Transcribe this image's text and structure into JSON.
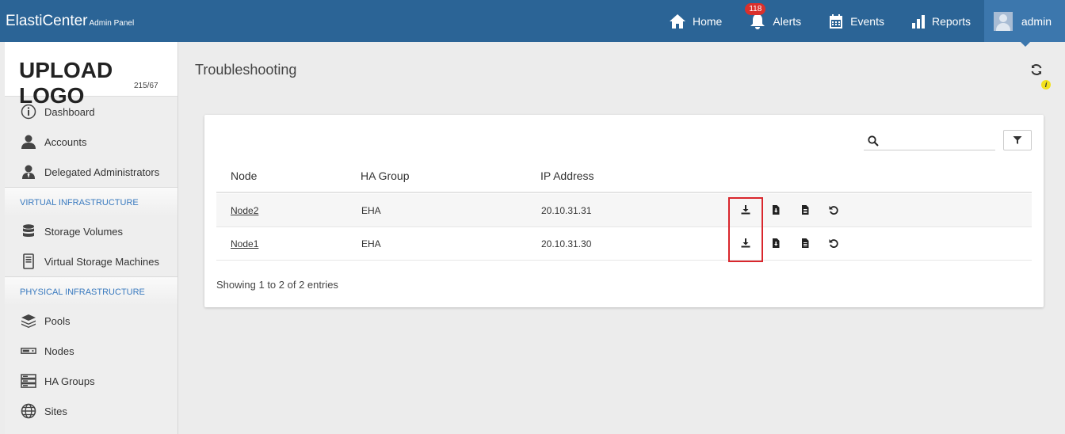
{
  "header": {
    "brand": "ElastiCenter",
    "brand_sub": "Admin Panel",
    "nav": [
      {
        "label": "Home",
        "icon": "home-icon"
      },
      {
        "label": "Alerts",
        "icon": "bell-icon",
        "badge": "118"
      },
      {
        "label": "Events",
        "icon": "calendar-icon"
      },
      {
        "label": "Reports",
        "icon": "bar-chart-icon"
      },
      {
        "label": "admin",
        "icon": "avatar"
      }
    ]
  },
  "sidebar": {
    "logo_title": "UPLOAD LOGO",
    "logo_dims": "215/67",
    "items_top": [
      {
        "label": "Dashboard",
        "icon": "info-circle-icon"
      },
      {
        "label": "Accounts",
        "icon": "user-icon"
      },
      {
        "label": "Delegated Administrators",
        "icon": "user-tie-icon"
      }
    ],
    "section_virtual": "VIRTUAL INFRASTRUCTURE",
    "items_virtual": [
      {
        "label": "Storage Volumes",
        "icon": "database-icon"
      },
      {
        "label": "Virtual Storage Machines",
        "icon": "server-tower-icon"
      }
    ],
    "section_physical": "PHYSICAL INFRASTRUCTURE",
    "items_physical": [
      {
        "label": "Pools",
        "icon": "layers-icon"
      },
      {
        "label": "Nodes",
        "icon": "node-bar-icon"
      },
      {
        "label": "HA Groups",
        "icon": "server-stack-icon"
      },
      {
        "label": "Sites",
        "icon": "globe-icon"
      }
    ]
  },
  "main": {
    "title": "Troubleshooting",
    "info_marker": "i",
    "search": {
      "placeholder": "",
      "value": ""
    },
    "table": {
      "columns": [
        "Node",
        "HA Group",
        "IP Address"
      ],
      "rows": [
        {
          "node": "Node2",
          "ha_group": "EHA",
          "ip": "20.10.31.31"
        },
        {
          "node": "Node1",
          "ha_group": "EHA",
          "ip": "20.10.31.30"
        }
      ],
      "row_actions": [
        "download-icon",
        "file-download-icon",
        "file-text-icon",
        "undo-icon"
      ]
    },
    "footer": "Showing 1 to 2 of 2 entries"
  },
  "colors": {
    "topbar": "#2b6496",
    "admin_tab": "#3c77ad",
    "badge": "#d9302c",
    "section_label": "#3a7abf",
    "highlight": "#d9262c"
  }
}
